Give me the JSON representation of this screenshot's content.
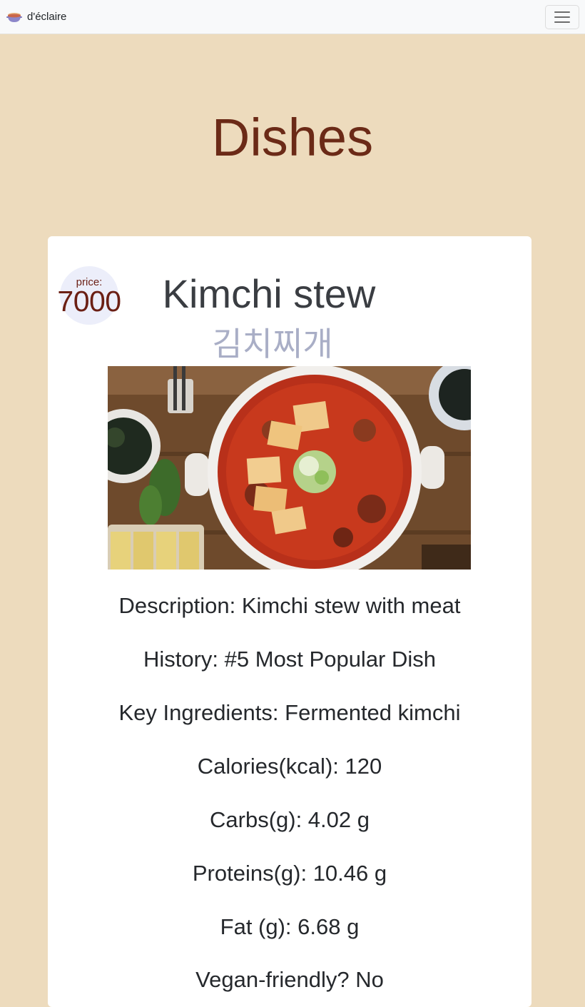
{
  "nav": {
    "brand": "d'éclaire",
    "brand_icon": "soup-pot-icon",
    "menu_icon": "hamburger-menu-icon"
  },
  "page": {
    "title": "Dishes"
  },
  "dish": {
    "price_label": "price:",
    "price": "7000",
    "name": "Kimchi stew",
    "name_korean": "김치찌개",
    "image_subject": "kimchi-stew-photo",
    "description": "Description: Kimchi stew with meat",
    "history": "History: #5 Most Popular Dish",
    "key_ingredients": "Key Ingredients: Fermented kimchi",
    "calories": "Calories(kcal): 120",
    "carbs": "Carbs(g): 4.02 g",
    "proteins": "Proteins(g): 10.46 g",
    "fat": "Fat (g): 6.68 g",
    "vegan": "Vegan-friendly? No"
  },
  "colors": {
    "background": "#eddbbd",
    "title": "#6b2a17",
    "price": "#6b1f14",
    "korean": "#a9aec6"
  }
}
